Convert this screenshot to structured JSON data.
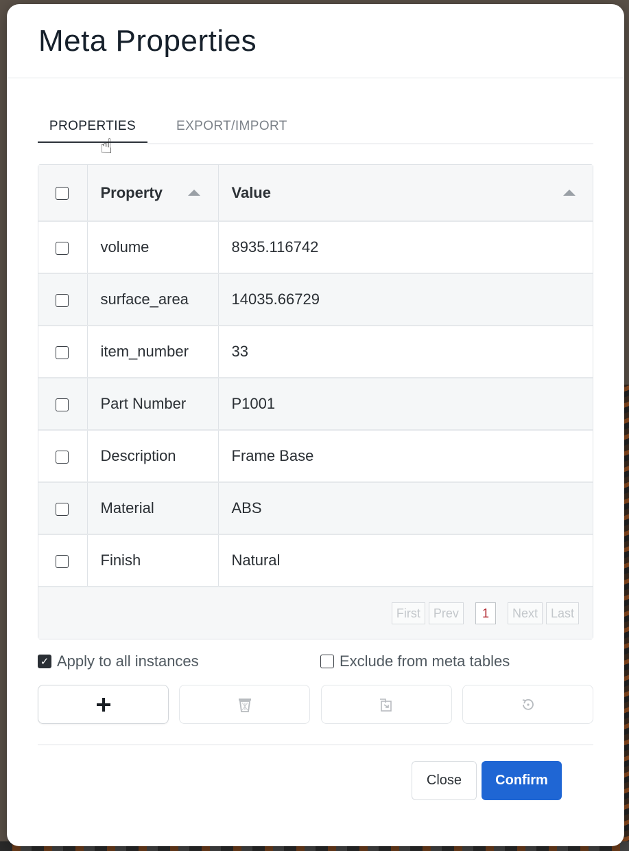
{
  "dialog": {
    "title": "Meta Properties"
  },
  "tabs": [
    {
      "label": "PROPERTIES",
      "active": true
    },
    {
      "label": "EXPORT/IMPORT",
      "active": false
    }
  ],
  "table": {
    "columns": [
      "Property",
      "Value"
    ],
    "rows": [
      {
        "property": "volume",
        "value": "8935.116742",
        "checked": false
      },
      {
        "property": "surface_area",
        "value": "14035.66729",
        "checked": false
      },
      {
        "property": "item_number",
        "value": "33",
        "checked": false
      },
      {
        "property": "Part Number",
        "value": "P1001",
        "checked": false
      },
      {
        "property": "Description",
        "value": "Frame Base",
        "checked": false
      },
      {
        "property": "Material",
        "value": "ABS",
        "checked": false
      },
      {
        "property": "Finish",
        "value": "Natural",
        "checked": false
      }
    ]
  },
  "pagination": {
    "first": "First",
    "prev": "Prev",
    "current": "1",
    "next": "Next",
    "last": "Last"
  },
  "options": {
    "apply_all": {
      "label": "Apply to all instances",
      "checked": true
    },
    "exclude_meta": {
      "label": "Exclude from meta tables",
      "checked": false
    }
  },
  "actions": [
    {
      "icon": "plus-icon",
      "enabled": true
    },
    {
      "icon": "trash-icon",
      "enabled": false
    },
    {
      "icon": "paste-icon",
      "enabled": false
    },
    {
      "icon": "reset-icon",
      "enabled": false
    }
  ],
  "footer": {
    "close_label": "Close",
    "confirm_label": "Confirm"
  },
  "colors": {
    "primary": "#1f66d4",
    "current_page": "#b0262e"
  }
}
